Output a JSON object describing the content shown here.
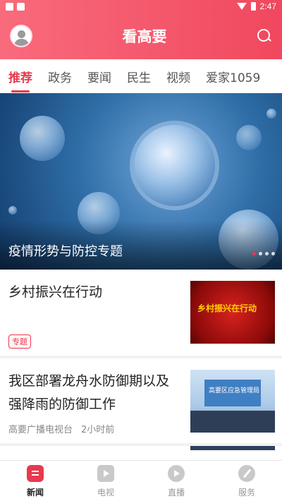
{
  "status_bar": {
    "time": "2:47"
  },
  "app": {
    "title": "看高要"
  },
  "tabs": [
    {
      "label": "推荐"
    },
    {
      "label": "政务"
    },
    {
      "label": "要闻"
    },
    {
      "label": "民生"
    },
    {
      "label": "视频"
    },
    {
      "label": "爱家1059"
    }
  ],
  "banner": {
    "caption": "疫情形势与防控专题",
    "page_count": 4,
    "active_page": 1
  },
  "news": [
    {
      "title": "乡村振兴在行动",
      "tag": "专题",
      "thumb_text": "乡村振兴在行动"
    },
    {
      "title": "我区部署龙舟水防御期以及强降雨的防御工作",
      "source": "高要广播电视台",
      "time": "2小时前",
      "thumb_text": "高要区应急管理局"
    }
  ],
  "bottom_nav": [
    {
      "label": "新闻",
      "icon": "news-icon"
    },
    {
      "label": "电视",
      "icon": "tv-icon"
    },
    {
      "label": "直播",
      "icon": "play-icon"
    },
    {
      "label": "服务",
      "icon": "compass-icon"
    }
  ],
  "colors": {
    "accent": "#e8394f",
    "header_start": "#f96b7c",
    "header_end": "#f0485e"
  }
}
